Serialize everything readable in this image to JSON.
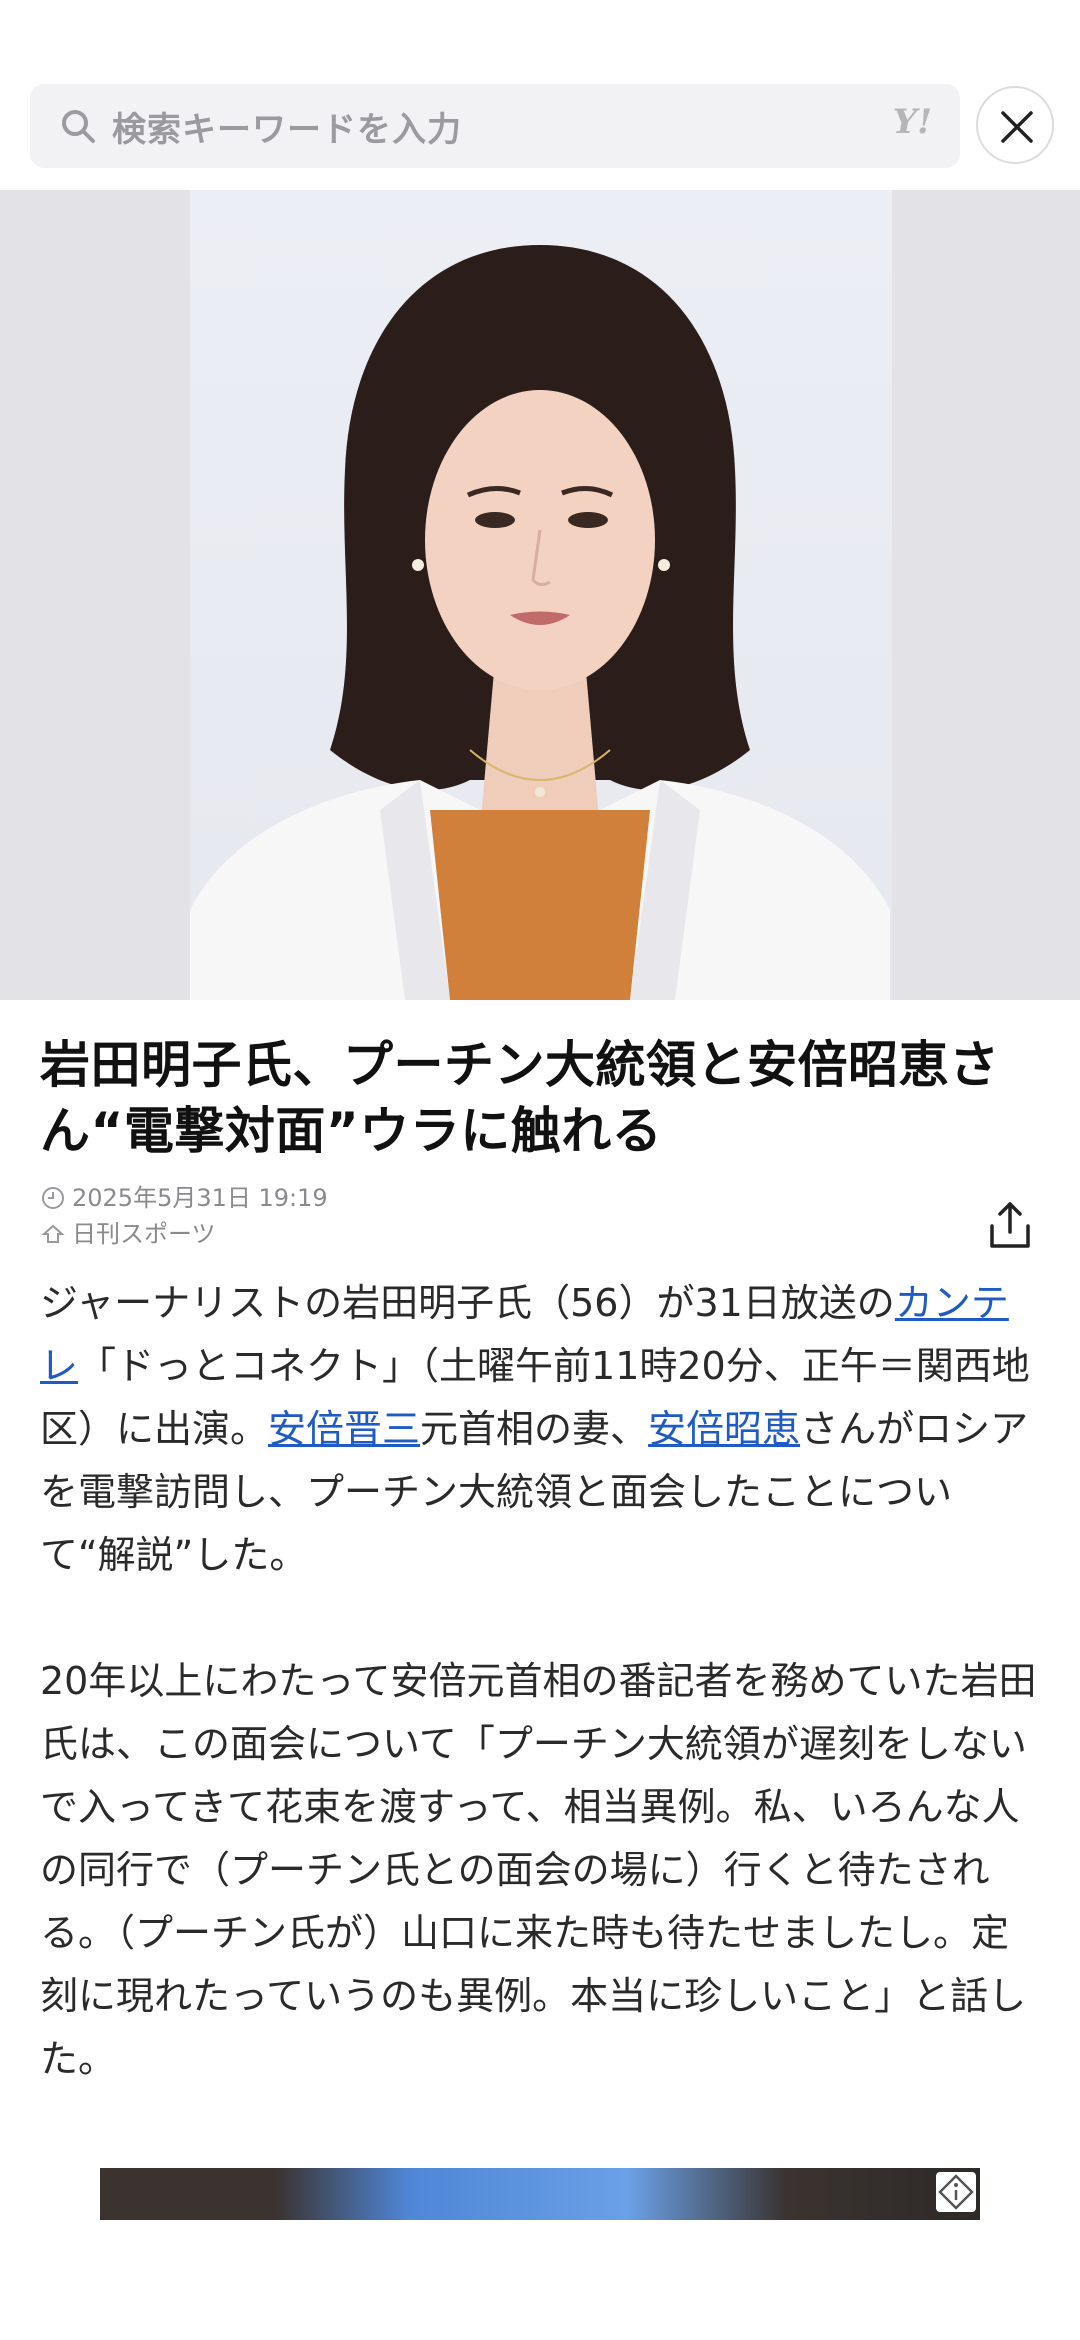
{
  "search": {
    "placeholder": "検索キーワードを入力",
    "logo": "Y!"
  },
  "article": {
    "title": "岩田明子氏、プーチン大統領と安倍昭恵さん“電撃対面”ウラに触れる",
    "date": "2025年5月31日 19:19",
    "source": "日刊スポーツ",
    "p1": {
      "t1": "ジャーナリストの岩田明子氏（56）が31日放送の",
      "link1": "カンテレ",
      "t2": "「ドっとコネクト」（土曜午前11時20分、正午＝関西地区）に出演。",
      "link2": "安倍晋三",
      "t3": "元首相の妻、",
      "link3": "安倍昭恵",
      "t4": "さんがロシアを電撃訪問し、プーチン大統領と面会したことについて“解説”した。"
    },
    "p2": "20年以上にわたって安倍元首相の番記者を務めていた岩田氏は、この面会について「プーチン大統領が遅刻をしないで入ってきて花束を渡すって、相当異例。私、いろんな人の同行で（プーチン氏との面会の場に）行くと待たされる。（プーチン氏が）山口に来た時も待たせましたし。定刻に現れたっていうのも異例。本当に珍しいこと」と話した。"
  },
  "icons": {
    "search": "search-icon",
    "close": "close-icon",
    "clock": "clock-icon",
    "source": "source-icon",
    "share": "share-icon",
    "ad": "ad-info-icon"
  },
  "colors": {
    "link": "#1f5bc6",
    "jacket_accent": "#d0803a"
  }
}
